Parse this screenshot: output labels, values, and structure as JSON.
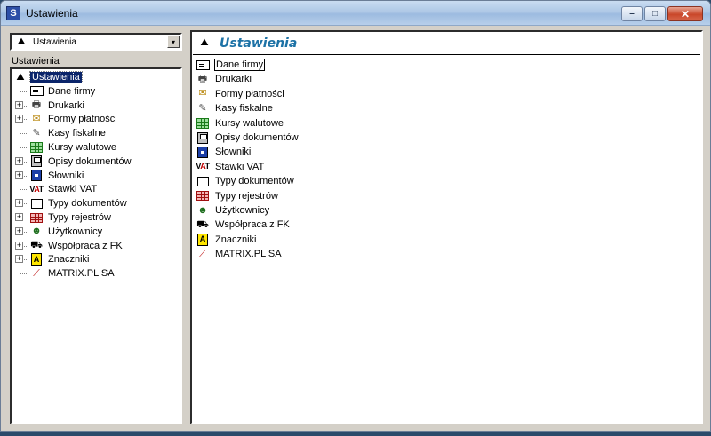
{
  "window": {
    "title": "Ustawienia",
    "app_icon_letter": "S",
    "minimize_glyph": "–",
    "maximize_glyph": "□",
    "close_glyph": "✕"
  },
  "left": {
    "combo_value": "Ustawienia",
    "combo_arrow": "▾",
    "tree_header": "Ustawienia",
    "tree": [
      {
        "label": "Ustawienia",
        "icon": "settings-icon",
        "level": 0,
        "expander": null,
        "selected": true
      },
      {
        "label": "Dane firmy",
        "icon": "company-card-icon",
        "level": 1,
        "expander": null
      },
      {
        "label": "Drukarki",
        "icon": "printer-icon",
        "level": 1,
        "expander": "+"
      },
      {
        "label": "Formy płatności",
        "icon": "payment-icon",
        "level": 1,
        "expander": "+"
      },
      {
        "label": "Kasy fiskalne",
        "icon": "cash-register-icon",
        "level": 1,
        "expander": null
      },
      {
        "label": "Kursy walutowe",
        "icon": "table-grid-icon",
        "level": 1,
        "expander": null
      },
      {
        "label": "Opisy dokumentów",
        "icon": "floppy-disk-icon",
        "level": 1,
        "expander": "+"
      },
      {
        "label": "Słowniki",
        "icon": "dictionary-icon",
        "level": 1,
        "expander": "+"
      },
      {
        "label": "Stawki VAT",
        "icon": "vat-icon",
        "level": 1,
        "expander": null
      },
      {
        "label": "Typy dokumentów",
        "icon": "document-type-icon",
        "level": 1,
        "expander": "+"
      },
      {
        "label": "Typy rejestrów",
        "icon": "register-grid-icon",
        "level": 1,
        "expander": "+"
      },
      {
        "label": "Użytkownicy",
        "icon": "users-icon",
        "level": 1,
        "expander": "+"
      },
      {
        "label": "Współpraca z FK",
        "icon": "handshake-icon",
        "level": 1,
        "expander": "+"
      },
      {
        "label": "Znaczniki",
        "icon": "tag-icon",
        "level": 1,
        "expander": "+"
      },
      {
        "label": "MATRIX.PL SA",
        "icon": "matrix-logo-icon",
        "level": 1,
        "expander": null
      }
    ]
  },
  "right": {
    "title": "Ustawienia",
    "items": [
      {
        "label": "Dane firmy",
        "icon": "company-card-icon",
        "focused": true
      },
      {
        "label": "Drukarki",
        "icon": "printer-icon"
      },
      {
        "label": "Formy płatności",
        "icon": "payment-icon"
      },
      {
        "label": "Kasy fiskalne",
        "icon": "cash-register-icon"
      },
      {
        "label": "Kursy walutowe",
        "icon": "table-grid-icon"
      },
      {
        "label": "Opisy dokumentów",
        "icon": "floppy-disk-icon"
      },
      {
        "label": "Słowniki",
        "icon": "dictionary-icon"
      },
      {
        "label": "Stawki VAT",
        "icon": "vat-icon"
      },
      {
        "label": "Typy dokumentów",
        "icon": "document-type-icon"
      },
      {
        "label": "Typy rejestrów",
        "icon": "register-grid-icon"
      },
      {
        "label": "Użytkownicy",
        "icon": "users-icon"
      },
      {
        "label": "Współpraca z FK",
        "icon": "handshake-icon"
      },
      {
        "label": "Znaczniki",
        "icon": "tag-icon"
      },
      {
        "label": "MATRIX.PL SA",
        "icon": "matrix-logo-icon"
      }
    ]
  },
  "colors": {
    "selection": "#0a246a",
    "header_title": "#1d72a6",
    "window_face": "#d4d0c8"
  }
}
